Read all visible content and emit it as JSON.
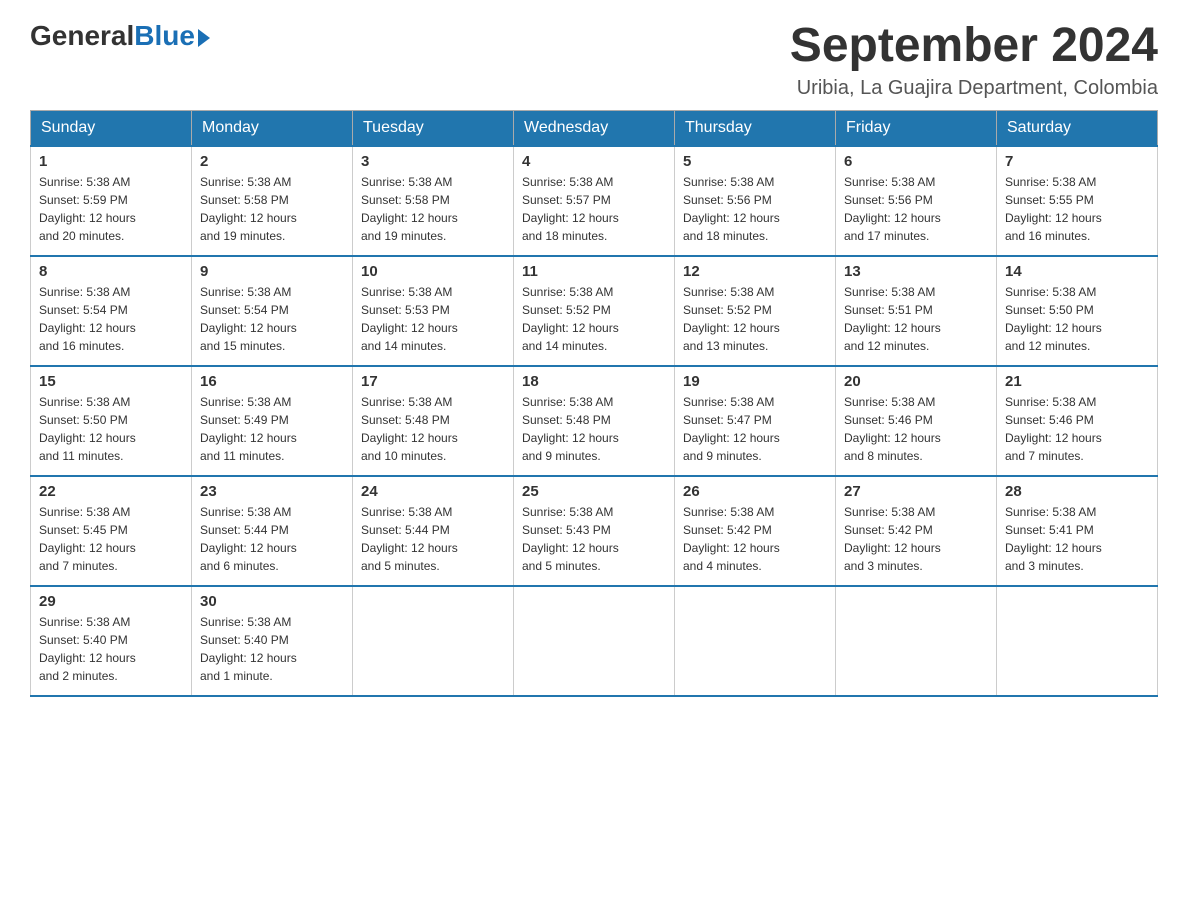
{
  "logo": {
    "general": "General",
    "blue": "Blue"
  },
  "title": "September 2024",
  "subtitle": "Uribia, La Guajira Department, Colombia",
  "days_of_week": [
    "Sunday",
    "Monday",
    "Tuesday",
    "Wednesday",
    "Thursday",
    "Friday",
    "Saturday"
  ],
  "weeks": [
    [
      {
        "day": "1",
        "sunrise": "5:38 AM",
        "sunset": "5:59 PM",
        "daylight": "12 hours and 20 minutes."
      },
      {
        "day": "2",
        "sunrise": "5:38 AM",
        "sunset": "5:58 PM",
        "daylight": "12 hours and 19 minutes."
      },
      {
        "day": "3",
        "sunrise": "5:38 AM",
        "sunset": "5:58 PM",
        "daylight": "12 hours and 19 minutes."
      },
      {
        "day": "4",
        "sunrise": "5:38 AM",
        "sunset": "5:57 PM",
        "daylight": "12 hours and 18 minutes."
      },
      {
        "day": "5",
        "sunrise": "5:38 AM",
        "sunset": "5:56 PM",
        "daylight": "12 hours and 18 minutes."
      },
      {
        "day": "6",
        "sunrise": "5:38 AM",
        "sunset": "5:56 PM",
        "daylight": "12 hours and 17 minutes."
      },
      {
        "day": "7",
        "sunrise": "5:38 AM",
        "sunset": "5:55 PM",
        "daylight": "12 hours and 16 minutes."
      }
    ],
    [
      {
        "day": "8",
        "sunrise": "5:38 AM",
        "sunset": "5:54 PM",
        "daylight": "12 hours and 16 minutes."
      },
      {
        "day": "9",
        "sunrise": "5:38 AM",
        "sunset": "5:54 PM",
        "daylight": "12 hours and 15 minutes."
      },
      {
        "day": "10",
        "sunrise": "5:38 AM",
        "sunset": "5:53 PM",
        "daylight": "12 hours and 14 minutes."
      },
      {
        "day": "11",
        "sunrise": "5:38 AM",
        "sunset": "5:52 PM",
        "daylight": "12 hours and 14 minutes."
      },
      {
        "day": "12",
        "sunrise": "5:38 AM",
        "sunset": "5:52 PM",
        "daylight": "12 hours and 13 minutes."
      },
      {
        "day": "13",
        "sunrise": "5:38 AM",
        "sunset": "5:51 PM",
        "daylight": "12 hours and 12 minutes."
      },
      {
        "day": "14",
        "sunrise": "5:38 AM",
        "sunset": "5:50 PM",
        "daylight": "12 hours and 12 minutes."
      }
    ],
    [
      {
        "day": "15",
        "sunrise": "5:38 AM",
        "sunset": "5:50 PM",
        "daylight": "12 hours and 11 minutes."
      },
      {
        "day": "16",
        "sunrise": "5:38 AM",
        "sunset": "5:49 PM",
        "daylight": "12 hours and 11 minutes."
      },
      {
        "day": "17",
        "sunrise": "5:38 AM",
        "sunset": "5:48 PM",
        "daylight": "12 hours and 10 minutes."
      },
      {
        "day": "18",
        "sunrise": "5:38 AM",
        "sunset": "5:48 PM",
        "daylight": "12 hours and 9 minutes."
      },
      {
        "day": "19",
        "sunrise": "5:38 AM",
        "sunset": "5:47 PM",
        "daylight": "12 hours and 9 minutes."
      },
      {
        "day": "20",
        "sunrise": "5:38 AM",
        "sunset": "5:46 PM",
        "daylight": "12 hours and 8 minutes."
      },
      {
        "day": "21",
        "sunrise": "5:38 AM",
        "sunset": "5:46 PM",
        "daylight": "12 hours and 7 minutes."
      }
    ],
    [
      {
        "day": "22",
        "sunrise": "5:38 AM",
        "sunset": "5:45 PM",
        "daylight": "12 hours and 7 minutes."
      },
      {
        "day": "23",
        "sunrise": "5:38 AM",
        "sunset": "5:44 PM",
        "daylight": "12 hours and 6 minutes."
      },
      {
        "day": "24",
        "sunrise": "5:38 AM",
        "sunset": "5:44 PM",
        "daylight": "12 hours and 5 minutes."
      },
      {
        "day": "25",
        "sunrise": "5:38 AM",
        "sunset": "5:43 PM",
        "daylight": "12 hours and 5 minutes."
      },
      {
        "day": "26",
        "sunrise": "5:38 AM",
        "sunset": "5:42 PM",
        "daylight": "12 hours and 4 minutes."
      },
      {
        "day": "27",
        "sunrise": "5:38 AM",
        "sunset": "5:42 PM",
        "daylight": "12 hours and 3 minutes."
      },
      {
        "day": "28",
        "sunrise": "5:38 AM",
        "sunset": "5:41 PM",
        "daylight": "12 hours and 3 minutes."
      }
    ],
    [
      {
        "day": "29",
        "sunrise": "5:38 AM",
        "sunset": "5:40 PM",
        "daylight": "12 hours and 2 minutes."
      },
      {
        "day": "30",
        "sunrise": "5:38 AM",
        "sunset": "5:40 PM",
        "daylight": "12 hours and 1 minute."
      },
      null,
      null,
      null,
      null,
      null
    ]
  ]
}
